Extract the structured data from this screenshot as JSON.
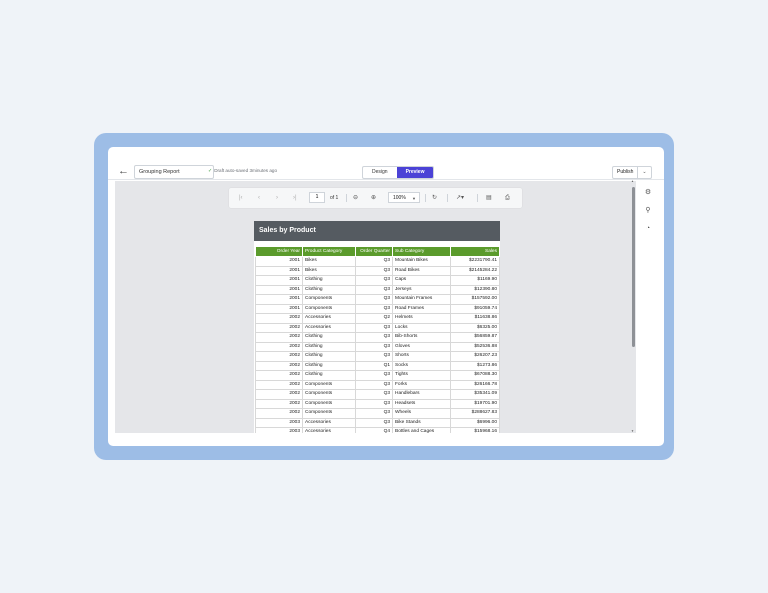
{
  "header": {
    "report_name": "Grouping Report",
    "autosave_text": "Draft auto-saved 3minutes ago",
    "tabs": [
      {
        "label": "Design"
      },
      {
        "label": "Preview"
      }
    ],
    "active_tab": "Preview",
    "publish_label": "Publish"
  },
  "toolbar": {
    "page_value": "1",
    "page_of": "of 1",
    "zoom_value": "100%"
  },
  "report": {
    "title": "Sales by Product",
    "columns": [
      "Order Year",
      "Product Category",
      "Order Quarter",
      "Sub Category",
      "Sales"
    ],
    "rows": [
      [
        "2001",
        "Bikes",
        "Q3",
        "Mountain Bikes",
        "$2231790.41"
      ],
      [
        "2001",
        "Bikes",
        "Q3",
        "Road Bikes",
        "$2145284.22"
      ],
      [
        "2001",
        "Clothing",
        "Q3",
        "Caps",
        "$1169.90"
      ],
      [
        "2001",
        "Clothing",
        "Q3",
        "Jerseys",
        "$12390.80"
      ],
      [
        "2001",
        "Components",
        "Q3",
        "Mountain Frames",
        "$157592.00"
      ],
      [
        "2001",
        "Components",
        "Q3",
        "Road Frames",
        "$91059.74"
      ],
      [
        "2002",
        "Accessories",
        "Q2",
        "Helmets",
        "$11638.86"
      ],
      [
        "2002",
        "Accessories",
        "Q3",
        "Locks",
        "$6325.00"
      ],
      [
        "2002",
        "Clothing",
        "Q3",
        "Bib-Shorts",
        "$56859.87"
      ],
      [
        "2002",
        "Clothing",
        "Q3",
        "Gloves",
        "$52536.88"
      ],
      [
        "2002",
        "Clothing",
        "Q3",
        "Shorts",
        "$26207.23"
      ],
      [
        "2002",
        "Clothing",
        "Q1",
        "Socks",
        "$1273.86"
      ],
      [
        "2002",
        "Clothing",
        "Q3",
        "Tights",
        "$67088.30"
      ],
      [
        "2002",
        "Components",
        "Q3",
        "Forks",
        "$26166.78"
      ],
      [
        "2002",
        "Components",
        "Q3",
        "Handlebars",
        "$35341.09"
      ],
      [
        "2002",
        "Components",
        "Q3",
        "Headsets",
        "$19701.90"
      ],
      [
        "2002",
        "Components",
        "Q3",
        "Wheels",
        "$288627.83"
      ],
      [
        "2003",
        "Accessories",
        "Q3",
        "Bike Stands",
        "$6996.00"
      ],
      [
        "2003",
        "Accessories",
        "Q4",
        "Bottles and Cages",
        "$15968.16"
      ]
    ]
  },
  "icons": {
    "back": "back-arrow-icon",
    "settings": "gear-icon",
    "search": "search-icon",
    "gauge": "gauge-icon"
  },
  "colors": {
    "accent": "#4b42d6",
    "table_header": "#5b9b2c",
    "title_bar": "#555b61",
    "frame": "#9dbde6"
  }
}
